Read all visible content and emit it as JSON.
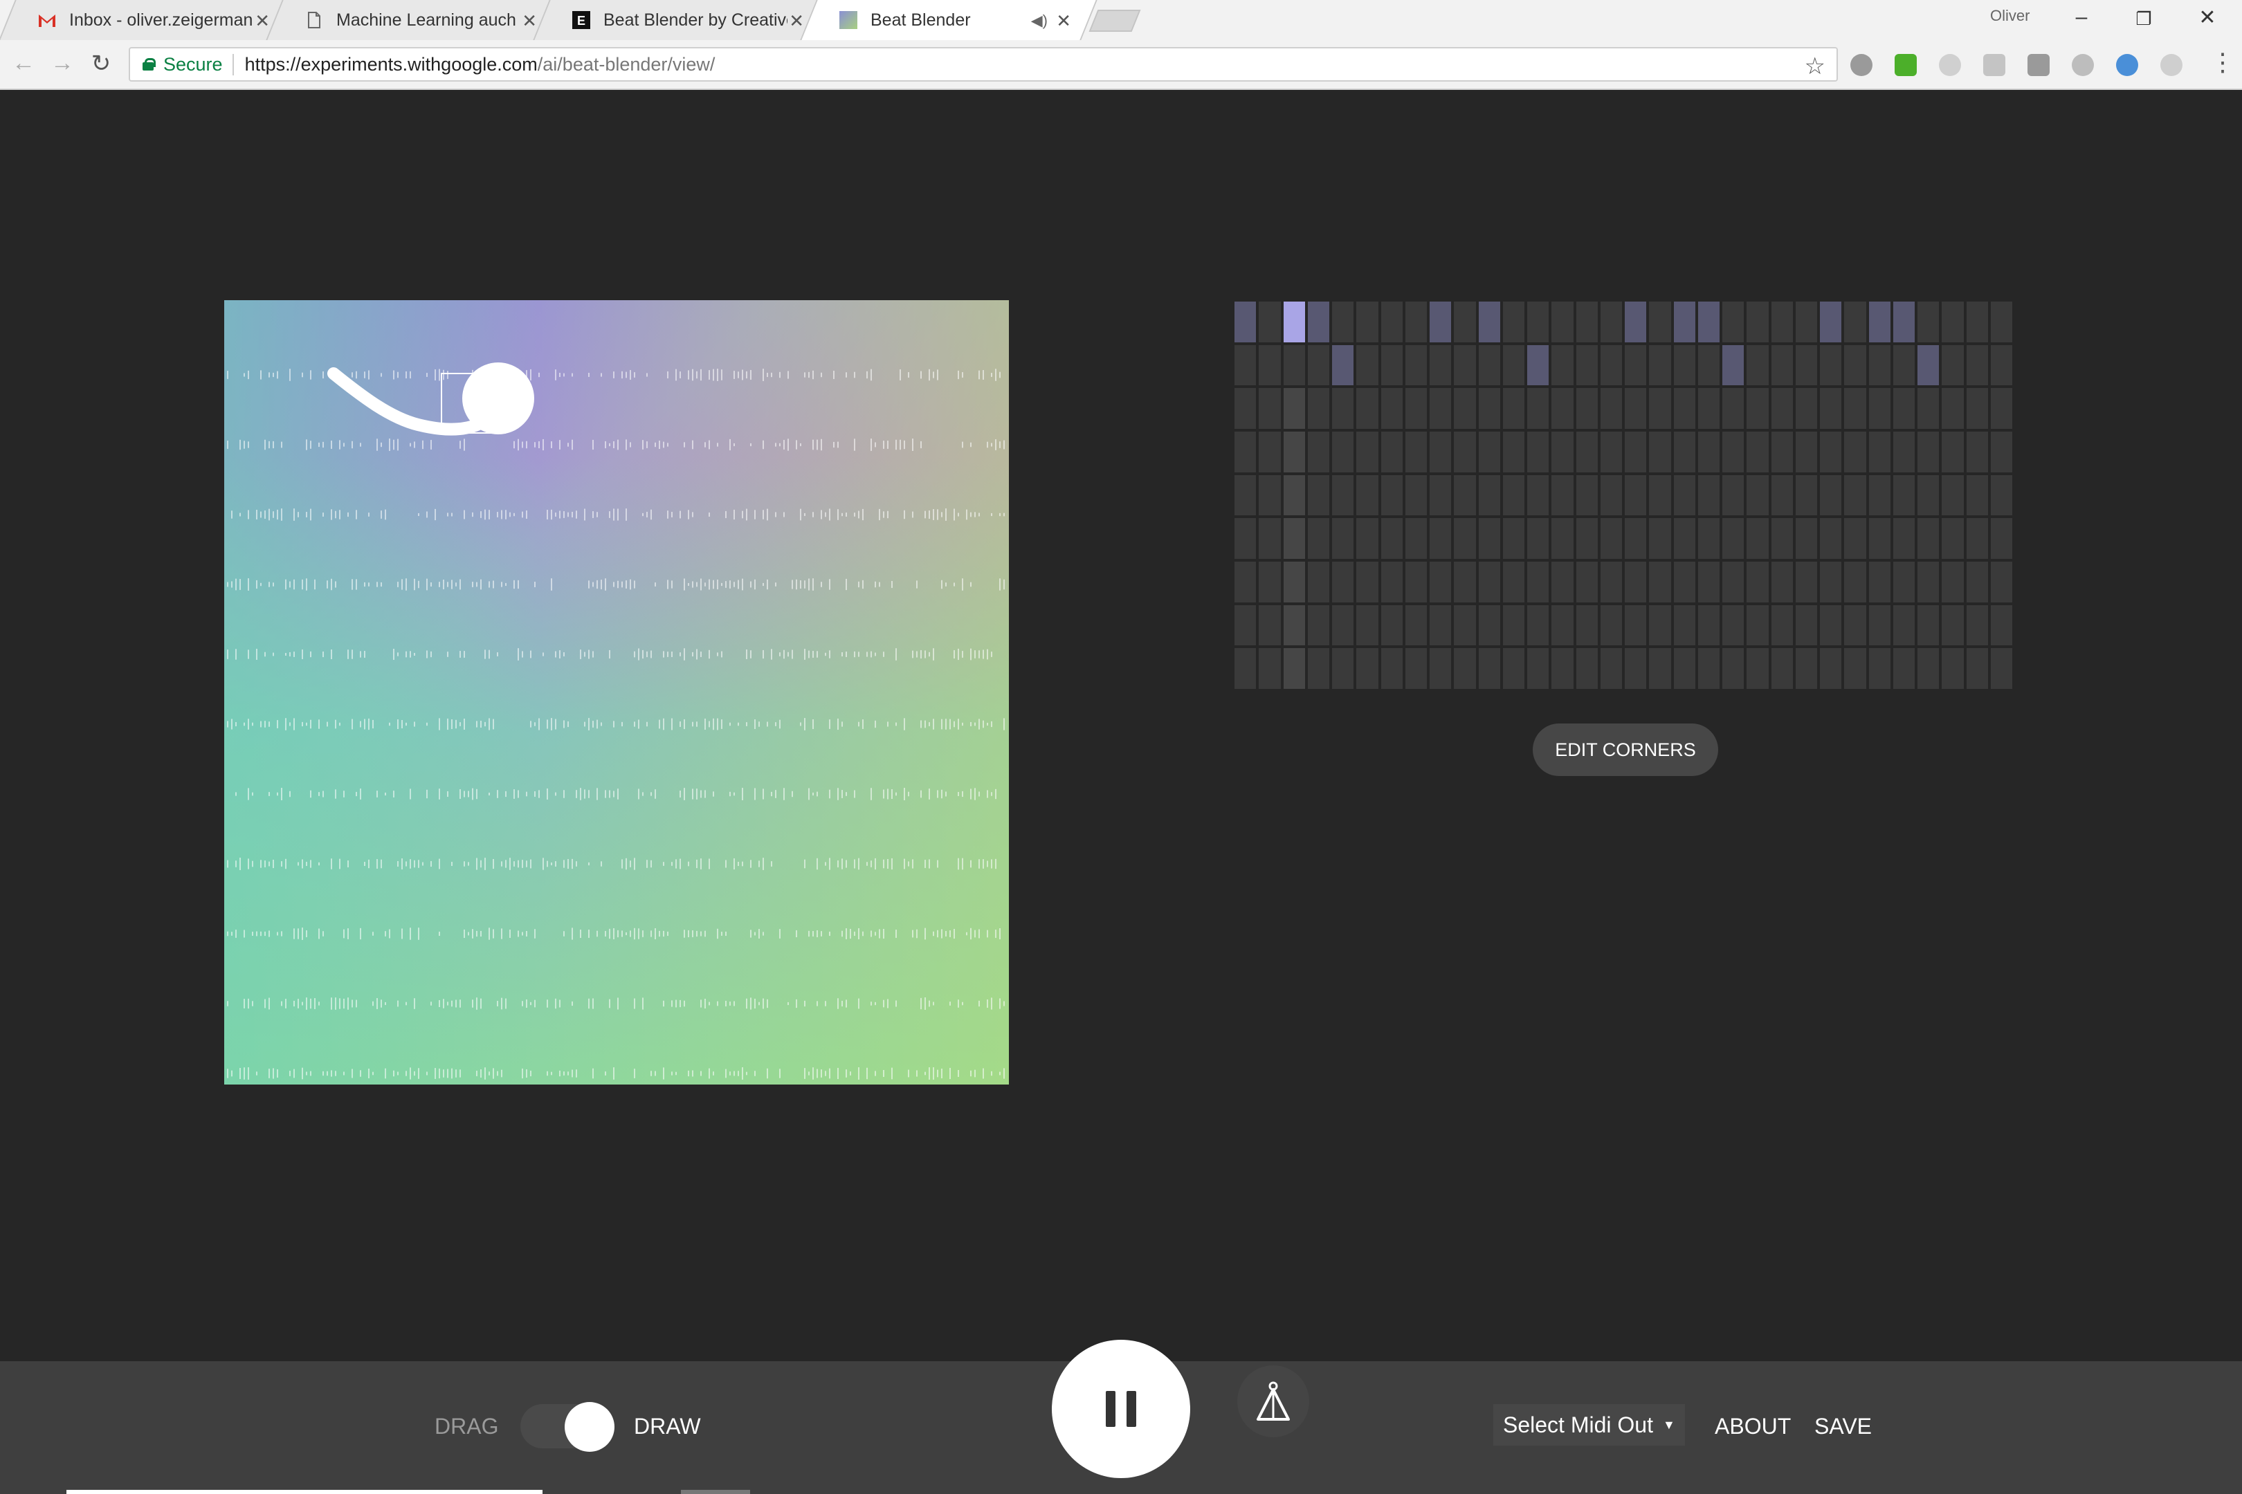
{
  "browser": {
    "tabs": [
      {
        "title": "Inbox - oliver.zeigermann",
        "icon": "gmail-icon",
        "active": false
      },
      {
        "title": "Machine Learning auch f",
        "icon": "document-icon",
        "active": false
      },
      {
        "title": "Beat Blender by Creative",
        "icon": "experiments-icon",
        "active": false
      },
      {
        "title": "Beat Blender",
        "icon": "beat-blender-icon",
        "active": true
      }
    ],
    "user": "Oliver",
    "secure_label": "Secure",
    "url_host": "https://experiments.withgoogle.com",
    "url_path": "/ai/beat-blender/view/"
  },
  "grid": {
    "columns": 32,
    "rows": 9,
    "colors": {
      "off": "#3a3a3a",
      "on": "#585872",
      "current": "#a9a5e6"
    },
    "current_step": 2,
    "active_steps": {
      "row0": [
        0,
        2,
        3,
        8,
        10,
        16,
        18,
        19,
        24,
        26,
        27
      ],
      "row1": [
        4,
        12,
        20,
        28
      ]
    }
  },
  "edit_corners_label": "EDIT CORNERS",
  "controls": {
    "drag_label": "DRAG",
    "draw_label": "DRAW",
    "mode": "draw",
    "play_state": "playing",
    "midi_label": "Select Midi Out",
    "about_label": "ABOUT",
    "save_label": "SAVE"
  }
}
